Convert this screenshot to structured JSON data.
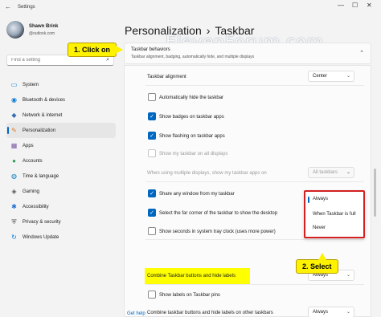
{
  "window": {
    "app_name": "Settings",
    "back_glyph": "←",
    "minimize": "—",
    "maximize": "☐",
    "close": "✕"
  },
  "profile": {
    "name": "Shawn Brink",
    "email": "@outlook.com"
  },
  "search": {
    "placeholder": "Find a setting",
    "icon": "search-icon"
  },
  "nav": [
    {
      "label": "System",
      "icon": "monitor-icon",
      "color": "#0078d4",
      "glyph": "▭"
    },
    {
      "label": "Bluetooth & devices",
      "icon": "bluetooth-icon",
      "color": "#0078d4",
      "glyph": "◉"
    },
    {
      "label": "Network & internet",
      "icon": "wifi-icon",
      "color": "#3a6fb0",
      "glyph": "◆"
    },
    {
      "label": "Personalization",
      "icon": "brush-icon",
      "color": "#e07b25",
      "glyph": "✎",
      "active": true
    },
    {
      "label": "Apps",
      "icon": "apps-icon",
      "color": "#7c5aa6",
      "glyph": "▦"
    },
    {
      "label": "Accounts",
      "icon": "person-icon",
      "color": "#2e9e5b",
      "glyph": "●"
    },
    {
      "label": "Time & language",
      "icon": "globe-icon",
      "color": "#0b7ec2",
      "glyph": "◍"
    },
    {
      "label": "Gaming",
      "icon": "gamepad-icon",
      "color": "#555555",
      "glyph": "◈"
    },
    {
      "label": "Accessibility",
      "icon": "accessibility-icon",
      "color": "#1d6fd1",
      "glyph": "✱"
    },
    {
      "label": "Privacy & security",
      "icon": "shield-icon",
      "color": "#555555",
      "glyph": "⛨"
    },
    {
      "label": "Windows Update",
      "icon": "update-icon",
      "color": "#0078d4",
      "glyph": "↻"
    }
  ],
  "header": {
    "parent": "Personalization",
    "separator": "›",
    "current": "Taskbar"
  },
  "watermark": "ElevenForum.com",
  "section": {
    "title": "Taskbar behaviors",
    "subtitle": "Taskbar alignment, badging, automatically hide, and multiple displays",
    "chevron": "⌃"
  },
  "settings": {
    "alignment": {
      "label": "Taskbar alignment",
      "value": "Center"
    },
    "auto_hide": {
      "label": "Automatically hide the taskbar",
      "checked": false
    },
    "badges": {
      "label": "Show badges on taskbar apps",
      "checked": true
    },
    "flashing": {
      "label": "Show flashing on taskbar apps",
      "checked": true
    },
    "all_displays": {
      "label": "Show my taskbar on all displays",
      "checked": false,
      "disabled": true
    },
    "multi_display": {
      "label": "When using multiple displays, show my taskbar apps on",
      "value": "All taskbars",
      "disabled": true
    },
    "share_window": {
      "label": "Share any window from my taskbar",
      "checked": true
    },
    "far_corner": {
      "label": "Select the far corner of the taskbar to show the desktop",
      "checked": true
    },
    "seconds_clock": {
      "label": "Show seconds in system tray clock (uses more power)",
      "checked": false
    },
    "combine": {
      "label": "Combine Taskbar buttons and hide labels",
      "value": "Always"
    },
    "pin_labels": {
      "label": "Show labels on Taskbar pins",
      "checked": false
    },
    "combine_other": {
      "label": "Combine taskbar buttons and hide labels on other taskbars",
      "value": "Always"
    }
  },
  "dropdown_menu": {
    "options": [
      "Always",
      "When Taskbar is full",
      "Never"
    ],
    "selected": "Always"
  },
  "callouts": {
    "step1": "1. Click on",
    "step2": "2. Select"
  },
  "footer": {
    "get_help": "Get help"
  },
  "colors": {
    "accent": "#0067c0",
    "highlight": "#ffff00",
    "callout": "#fff200",
    "menu_border": "#d42020"
  }
}
